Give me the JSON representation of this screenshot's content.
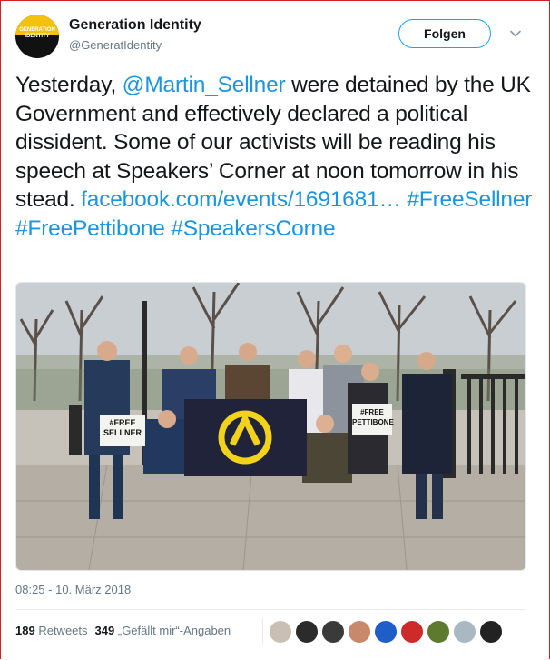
{
  "account": {
    "name": "Generation Identity",
    "handle": "@GeneratIdentity",
    "avatar_text_1": "GENERATION",
    "avatar_text_2": "IDENTITY"
  },
  "follow_label": "Folgen",
  "tweet": {
    "text_1": "Yesterday, ",
    "mention": "@Martin_Sellner",
    "text_2": " were detained by the UK Government and effectively declared a political dissident. Some of our activists will be reading his speech at Speakers’ Corner at noon tomorrow in his stead. ",
    "url": "facebook.com/events/1691681…",
    "hashtag_1": "#FreeSellner",
    "hashtag_2": "#FreePettibone",
    "hashtag_3": "#SpeakersCorne"
  },
  "photo": {
    "sign_left_1": "#FREE",
    "sign_left_2": "SELLNER",
    "sign_right_1": "#FREE",
    "sign_right_2": "PETTIBONE"
  },
  "timestamp": "08:25 - 10. März 2018",
  "stats": {
    "retweets_count": "189",
    "retweets_label": "Retweets",
    "likes_count": "349",
    "likes_label": "„Gefällt mir“-Angaben"
  },
  "colors": {
    "link": "#1b95e0",
    "follow_border": "#1da1f2",
    "brand_yellow": "#f4c20d"
  },
  "icons": [
    "chevron-down-icon"
  ]
}
